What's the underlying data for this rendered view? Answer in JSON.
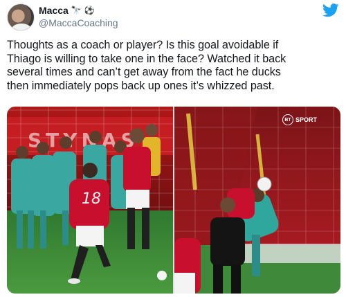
{
  "author": {
    "display_name": "Macca",
    "handle": "@MaccaCoaching",
    "emojis": [
      "telescope-emoji",
      "soccer-ball-emoji"
    ],
    "emoji_chars": [
      "🔭",
      "⚽"
    ]
  },
  "tweet": {
    "text_lines": [
      "Thoughts as a coach or player? Is this goal avoidable if",
      "Thiago is willing to take one in the face? Watched it back",
      "several times and can’t get away from the fact he ducks",
      "then immediately pops back up ones it’s whizzed past."
    ]
  },
  "media": {
    "left_image": {
      "shirt_number": "18",
      "stadium_text": "STYNAS"
    },
    "right_image": {
      "broadcaster_logo": "BT",
      "broadcaster_label": "SPORT"
    }
  },
  "colors": {
    "twitter_blue": "#1da1f2",
    "handle_gray": "#657786",
    "united_red": "#c8102e",
    "liverpool_teal": "#3aa8a0",
    "pitch_green": "#3f8a3a"
  },
  "icons": {
    "brand": "twitter-bird-icon"
  }
}
